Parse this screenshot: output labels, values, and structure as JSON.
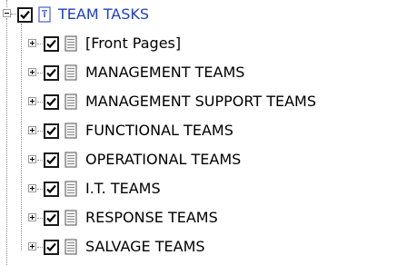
{
  "tree": {
    "root": {
      "label": "TEAM TASKS",
      "expanded": true,
      "checked": true,
      "icon": "book-icon",
      "color": "#1f3fbf"
    },
    "children": [
      {
        "label": "[Front Pages]",
        "checked": true,
        "expanded": false,
        "icon": "document-icon"
      },
      {
        "label": "MANAGEMENT TEAMS",
        "checked": true,
        "expanded": false,
        "icon": "document-icon"
      },
      {
        "label": "MANAGEMENT SUPPORT TEAMS",
        "checked": true,
        "expanded": false,
        "icon": "document-icon"
      },
      {
        "label": "FUNCTIONAL TEAMS",
        "checked": true,
        "expanded": false,
        "icon": "document-icon"
      },
      {
        "label": "OPERATIONAL TEAMS",
        "checked": true,
        "expanded": false,
        "icon": "document-icon"
      },
      {
        "label": "I.T. TEAMS",
        "checked": true,
        "expanded": false,
        "icon": "document-icon"
      },
      {
        "label": "RESPONSE TEAMS",
        "checked": true,
        "expanded": false,
        "icon": "document-icon"
      },
      {
        "label": "SALVAGE TEAMS",
        "checked": true,
        "expanded": false,
        "icon": "document-icon"
      }
    ]
  }
}
